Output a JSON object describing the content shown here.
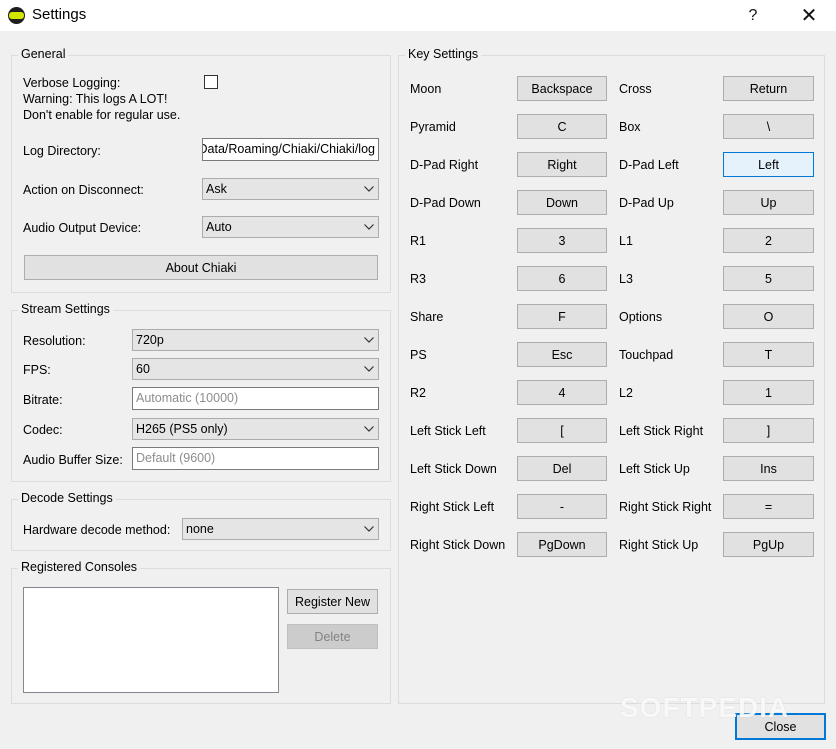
{
  "window": {
    "title": "Settings",
    "help_glyph": "?",
    "close_glyph": "✕"
  },
  "general": {
    "title": "General",
    "verbose_label_1": "Verbose Logging:",
    "verbose_label_2": "Warning: This logs A LOT!",
    "verbose_label_3": "Don't enable for regular use.",
    "verbose_checked": false,
    "log_dir_label": "Log Directory:",
    "log_dir_value": "C:/Users/User/AppData/Roaming/Chiaki/Chiaki/log",
    "disconnect_label": "Action on Disconnect:",
    "disconnect_value": "Ask",
    "audio_out_label": "Audio Output Device:",
    "audio_out_value": "Auto",
    "about_button": "About Chiaki"
  },
  "stream": {
    "title": "Stream Settings",
    "resolution_label": "Resolution:",
    "resolution_value": "720p",
    "fps_label": "FPS:",
    "fps_value": "60",
    "bitrate_label": "Bitrate:",
    "bitrate_placeholder": "Automatic (10000)",
    "codec_label": "Codec:",
    "codec_value": "H265 (PS5 only)",
    "audio_buffer_label": "Audio Buffer Size:",
    "audio_buffer_placeholder": "Default (9600)"
  },
  "decode": {
    "title": "Decode Settings",
    "hw_label": "Hardware decode method:",
    "hw_value": "none"
  },
  "consoles": {
    "title": "Registered Consoles",
    "register_button": "Register New",
    "delete_button": "Delete"
  },
  "keys": {
    "title": "Key Settings",
    "left": [
      {
        "name": "Moon",
        "key": "Backspace"
      },
      {
        "name": "Pyramid",
        "key": "C"
      },
      {
        "name": "D-Pad Right",
        "key": "Right"
      },
      {
        "name": "D-Pad Down",
        "key": "Down"
      },
      {
        "name": "R1",
        "key": "3"
      },
      {
        "name": "R3",
        "key": "6"
      },
      {
        "name": "Share",
        "key": "F"
      },
      {
        "name": "PS",
        "key": "Esc"
      },
      {
        "name": "R2",
        "key": "4"
      },
      {
        "name": "Left Stick Left",
        "key": "["
      },
      {
        "name": "Left Stick Down",
        "key": "Del"
      },
      {
        "name": "Right Stick Left",
        "key": "-"
      },
      {
        "name": "Right Stick Down",
        "key": "PgDown"
      }
    ],
    "right": [
      {
        "name": "Cross",
        "key": "Return"
      },
      {
        "name": "Box",
        "key": "\\"
      },
      {
        "name": "D-Pad Left",
        "key": "Left"
      },
      {
        "name": "D-Pad Up",
        "key": "Up"
      },
      {
        "name": "L1",
        "key": "2"
      },
      {
        "name": "L3",
        "key": "5"
      },
      {
        "name": "Options",
        "key": "O"
      },
      {
        "name": "Touchpad",
        "key": "T"
      },
      {
        "name": "L2",
        "key": "1"
      },
      {
        "name": "Left Stick Right",
        "key": "]"
      },
      {
        "name": "Left Stick Up",
        "key": "Ins"
      },
      {
        "name": "Right Stick Right",
        "key": "="
      },
      {
        "name": "Right Stick Up",
        "key": "PgUp"
      }
    ]
  },
  "footer": {
    "close_button": "Close"
  },
  "watermark": "SOFTPEDIA",
  "colors": {
    "accent": "#0078d7",
    "window_bg": "#f0f0f0",
    "button_bg": "#e1e1e1"
  }
}
